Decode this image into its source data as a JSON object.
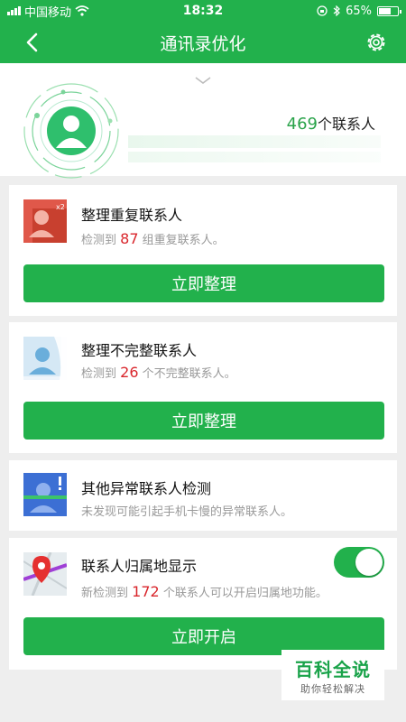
{
  "status_bar": {
    "carrier": "中国移动",
    "time": "18:32",
    "battery": "65%"
  },
  "nav": {
    "title": "通讯录优化",
    "back_icon": "back-arrow-icon",
    "settings_icon": "gear-icon"
  },
  "header": {
    "contact_count": "469",
    "contact_suffix": "个联系人"
  },
  "cards": {
    "duplicate": {
      "title": "整理重复联系人",
      "desc_prefix": "检测到 ",
      "count": "87",
      "desc_suffix": " 组重复联系人。",
      "badge": "x2",
      "button": "立即整理"
    },
    "incomplete": {
      "title": "整理不完整联系人",
      "desc_prefix": "检测到 ",
      "count": "26",
      "desc_suffix": " 个不完整联系人。",
      "button": "立即整理"
    },
    "abnormal": {
      "title": "其他异常联系人检测",
      "desc": "未发现可能引起手机卡慢的异常联系人。"
    },
    "location": {
      "title": "联系人归属地显示",
      "desc_prefix": "新检测到 ",
      "count": "172",
      "desc_suffix": " 个联系人可以开启归属地功能。",
      "toggle_on": true,
      "button": "立即开启"
    }
  },
  "watermark": {
    "title": "百科全说",
    "subtitle": "助你轻松解决"
  },
  "colors": {
    "accent": "#22b14c",
    "highlight": "#d9262c"
  }
}
